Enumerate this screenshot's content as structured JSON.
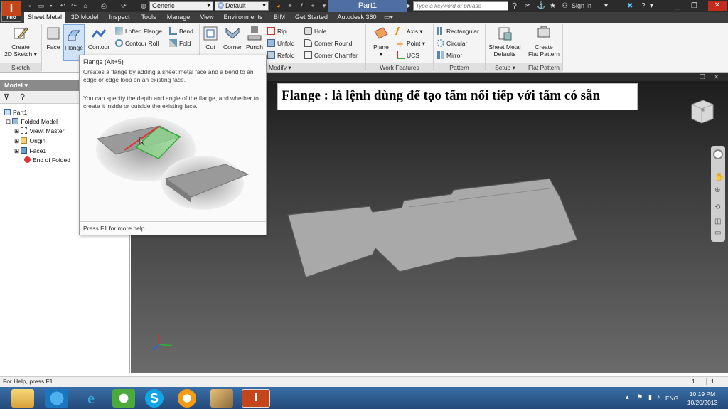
{
  "titlebar": {
    "logo_letter": "I",
    "logo_sub": "PRO",
    "material_combo": "Generic",
    "appearance_combo": "Default",
    "document_title": "Part1",
    "search_placeholder": "Type a keyword or phrase",
    "sign_in": "Sign In"
  },
  "menu_tabs": [
    {
      "label": "Sheet Metal",
      "active": true
    },
    {
      "label": "3D Model"
    },
    {
      "label": "Inspect"
    },
    {
      "label": "Tools"
    },
    {
      "label": "Manage"
    },
    {
      "label": "View"
    },
    {
      "label": "Environments"
    },
    {
      "label": "BIM"
    },
    {
      "label": "Get Started"
    },
    {
      "label": "Autodesk 360"
    }
  ],
  "ribbon": {
    "create_2d_sketch": [
      "Create",
      "2D Sketch"
    ],
    "face": "Face",
    "flange": "Flange",
    "contour": "Contour",
    "lofted_flange": "Lofted Flange",
    "contour_roll": "Contour Roll",
    "bend": "Bend",
    "fold": "Fold",
    "cut": "Cut",
    "corner": "Corner",
    "punch": "Punch",
    "rip": "Rip",
    "unfold": "Unfold",
    "refold": "Refold",
    "hole": "Hole",
    "corner_round": "Corner Round",
    "corner_chamfer": "Corner Chamfer",
    "plane": "Plane",
    "axis": "Axis",
    "point": "Point",
    "ucs": "UCS",
    "rectangular": "Rectangular",
    "circular": "Circular",
    "mirror": "Mirror",
    "sheet_metal_defaults": [
      "Sheet Metal",
      "Defaults"
    ],
    "create_flat_pattern": [
      "Create",
      "Flat Pattern"
    ],
    "panels": {
      "sketch": "Sketch",
      "modify": "Modify",
      "work_features": "Work Features",
      "pattern": "Pattern",
      "setup": "Setup",
      "flat_pattern": "Flat Pattern"
    }
  },
  "tooltip": {
    "title": "Flange (Alt+5)",
    "desc1": "Creates a flange by adding a sheet metal face and a bend to an edge or edge loop on an existing face.",
    "desc2": "You can specify the depth and angle of the flange, and whether to create it inside or outside the existing face.",
    "footer": "Press F1 for more help"
  },
  "model_panel": {
    "header": "Model",
    "tree": [
      {
        "label": "Part1"
      },
      {
        "label": "Folded Model"
      },
      {
        "label": "View: Master"
      },
      {
        "label": "Origin"
      },
      {
        "label": "Face1"
      },
      {
        "label": "End of Folded"
      }
    ]
  },
  "viewport": {
    "annotation": "Flange : là lệnh dùng để tạo tấm nối tiếp với tấm có sẵn",
    "colors": {
      "part": "#a9a9a9",
      "part_edge": "#5a5a5a"
    }
  },
  "statusbar": {
    "help_text": "For Help, press F1",
    "count1": "1",
    "count2": "1"
  },
  "taskbar": {
    "lang": "ENG",
    "time": "10:19 PM",
    "date": "10/20/2013"
  }
}
